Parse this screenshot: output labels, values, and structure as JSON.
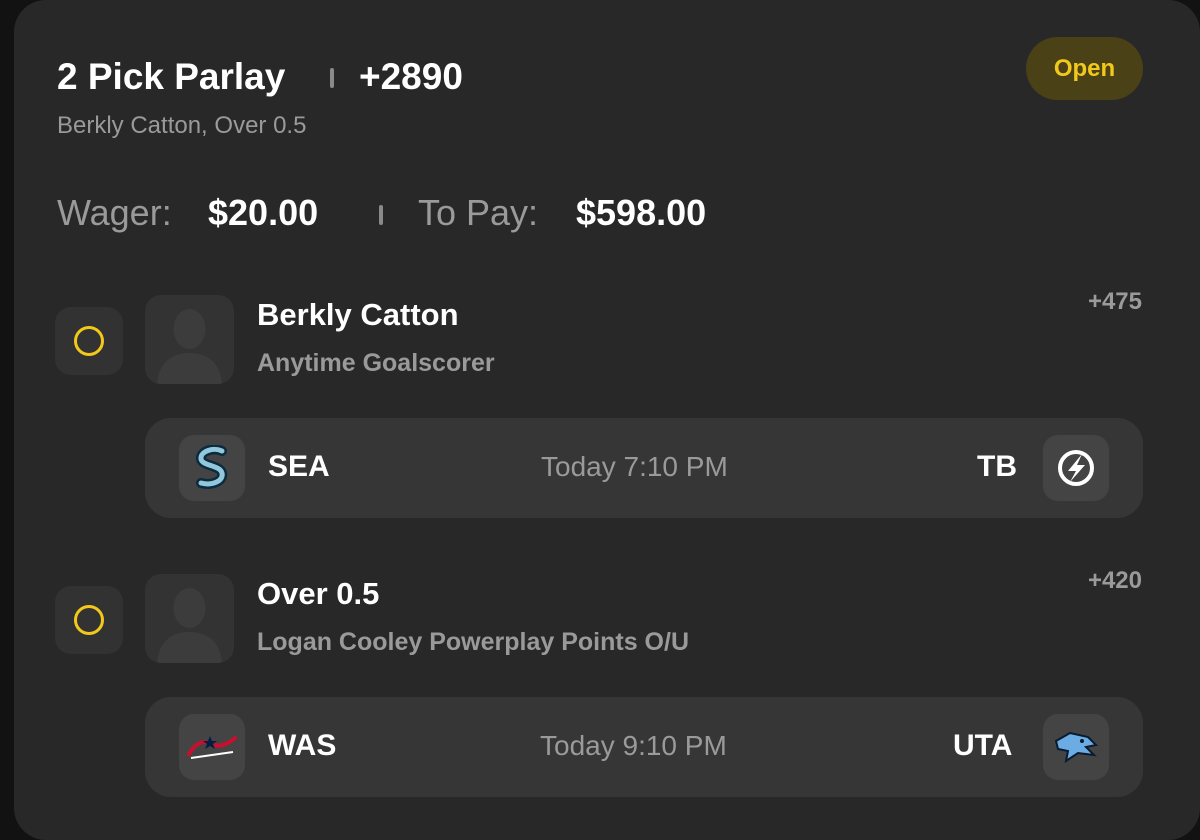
{
  "bet": {
    "title": "2 Pick Parlay",
    "total_odds": "+2890",
    "subtitle": "Berkly Catton, Over 0.5",
    "status": "Open",
    "wager_label": "Wager:",
    "wager_value": "$20.00",
    "topay_label": "To Pay:",
    "topay_value": "$598.00"
  },
  "picks": [
    {
      "title": "Berkly Catton",
      "market": "Anytime Goalscorer",
      "odds": "+475",
      "game": {
        "home": "SEA",
        "home_logo_icon": "kraken-logo-icon",
        "time": "Today 7:10 PM",
        "away": "TB",
        "away_logo_icon": "lightning-logo-icon"
      }
    },
    {
      "title": "Over 0.5",
      "market": "Logan Cooley Powerplay Points O/U",
      "odds": "+420",
      "game": {
        "home": "WAS",
        "home_logo_icon": "capitals-logo-icon",
        "time": "Today 9:10 PM",
        "away": "UTA",
        "away_logo_icon": "utah-logo-icon"
      }
    }
  ],
  "colors": {
    "background": "#282828",
    "accent": "#f2c91a",
    "status_badge_bg": "#4a4117",
    "muted_text": "#9a9a9a"
  }
}
